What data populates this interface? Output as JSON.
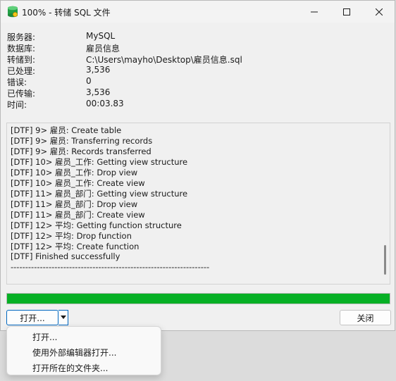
{
  "window": {
    "title": "100% - 转储 SQL 文件",
    "controls": {
      "minimize": "─",
      "maximize": "☐",
      "close": "✕"
    }
  },
  "info": [
    {
      "label": "服务器:",
      "value": "MySQL"
    },
    {
      "label": "数据库:",
      "value": "雇员信息"
    },
    {
      "label": "转储到:",
      "value": "C:\\Users\\mayho\\Desktop\\雇员信息.sql"
    },
    {
      "label": "已处理:",
      "value": "3,536"
    },
    {
      "label": "错误:",
      "value": "0"
    },
    {
      "label": "已传输:",
      "value": "3,536"
    },
    {
      "label": "时间:",
      "value": "00:03.83"
    }
  ],
  "log": [
    "[DTF] 9> 雇员: Create table",
    "[DTF] 9> 雇员: Transferring records",
    "[DTF] 9> 雇员: Records transferred",
    "[DTF] 10> 雇员_工作: Getting view structure",
    "[DTF] 10> 雇员_工作: Drop view",
    "[DTF] 10> 雇员_工作: Create view",
    "[DTF] 11> 雇员_部门: Getting view structure",
    "[DTF] 11> 雇员_部门: Drop view",
    "[DTF] 11> 雇员_部门: Create view",
    "[DTF] 12> 平均: Getting function structure",
    "[DTF] 12> 平均: Drop function",
    "[DTF] 12> 平均: Create function",
    "[DTF] Finished successfully",
    "--------------------------------------------------------------------"
  ],
  "progress": {
    "fraction": 1.0,
    "color": "#06b025"
  },
  "buttons": {
    "open": "打开...",
    "close": "关闭"
  },
  "menu": [
    "打开...",
    "使用外部编辑器打开...",
    "打开所在的文件夹..."
  ]
}
